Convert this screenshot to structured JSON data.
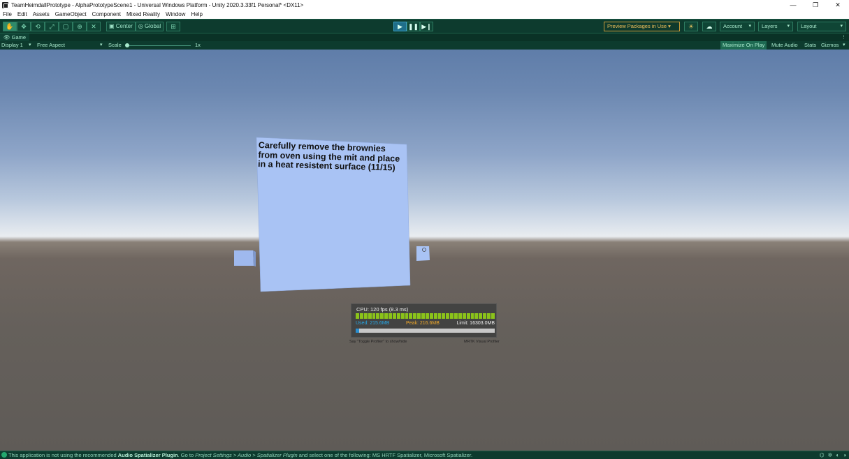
{
  "window": {
    "title": "TeamHeimdallPrototype - AlphaPrototypeScene1 - Universal Windows Platform - Unity 2020.3.33f1 Personal* <DX11>",
    "controls": [
      "—",
      "❐",
      "✕"
    ]
  },
  "menu": [
    "File",
    "Edit",
    "Assets",
    "GameObject",
    "Component",
    "Mixed Reality",
    "Window",
    "Help"
  ],
  "toolbar": {
    "tools": [
      "hand-tool-icon",
      "move-tool-icon",
      "rotate-tool-icon",
      "scale-tool-icon",
      "rect-tool-icon",
      "transform-tool-icon",
      "custom-tool-icon"
    ],
    "pivot_label": "Center",
    "space_label": "Global",
    "play_buttons": [
      "play-icon",
      "pause-icon",
      "step-icon"
    ],
    "preview_packages": "Preview Packages in Use",
    "account": "Account",
    "layers": "Layers",
    "layout": "Layout",
    "colors": {
      "background": "#0d3b2e",
      "accent": "#2f8a6a",
      "warning": "#f1c05a"
    }
  },
  "game_view": {
    "tab_label": "Game",
    "display": "Display 1",
    "aspect": "Free Aspect",
    "scale_label": "Scale",
    "scale_value": "1x",
    "maximize_on_play": "Maximize On Play",
    "mute_audio": "Mute Audio",
    "stats": "Stats",
    "gizmos": "Gizmos"
  },
  "scene": {
    "instruction_text": "Carefully remove the brownies from oven using the mit and place in a heat resistent surface (11/15)",
    "panel_color": "#a9c3f4"
  },
  "profiler": {
    "cpu": "CPU: 120 fps (8.3 ms)",
    "used": "Used: 215.6MB",
    "peak": "Peak: 216.6MB",
    "limit": "Limit: 16303.0MB",
    "memory_fraction": 0.013,
    "bar_count": 34,
    "hint": "Say \"Toggle Profiler\" to show/hide",
    "name": "MRTK Visual Profiler",
    "colors": {
      "bars": "#8bc31a",
      "used": "#27a8e8",
      "peak": "#f0a92a"
    }
  },
  "status": {
    "prefix": "This application is not using the recommended ",
    "bold": "Audio Spatializer Plugin",
    "mid1": ". Go to ",
    "italic1": "Project Settings > Audio > Spatializer Plugin",
    "suffix": " and select one of the following: MS HRTF Spatializer, Microsoft Spatializer."
  }
}
